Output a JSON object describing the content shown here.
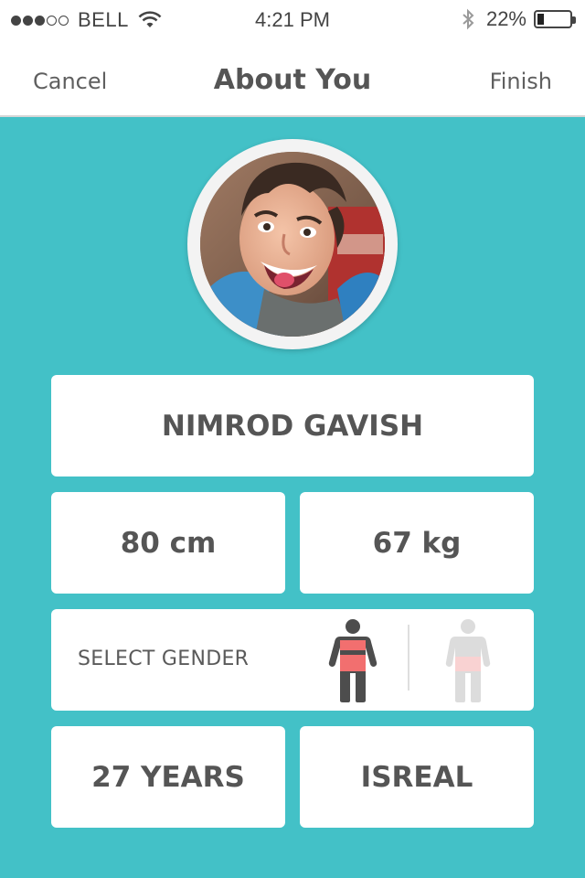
{
  "status_bar": {
    "carrier": "BELL",
    "time": "4:21 PM",
    "battery_percent": "22%",
    "battery_level": 0.22,
    "signal_icon": "signal-dots-icon",
    "wifi_icon": "wifi-icon",
    "bluetooth_icon": "bluetooth-icon"
  },
  "nav": {
    "cancel_label": "Cancel",
    "title": "About You",
    "finish_label": "Finish"
  },
  "profile": {
    "name": "NIMROD GAVISH",
    "height": "80 cm",
    "weight": "67 kg",
    "gender_label": "SELECT GENDER",
    "age": "27 YEARS",
    "country": "ISREAL"
  },
  "colors": {
    "background": "#43c1c7",
    "male_accent": "#f26f6f",
    "text": "#555555"
  }
}
